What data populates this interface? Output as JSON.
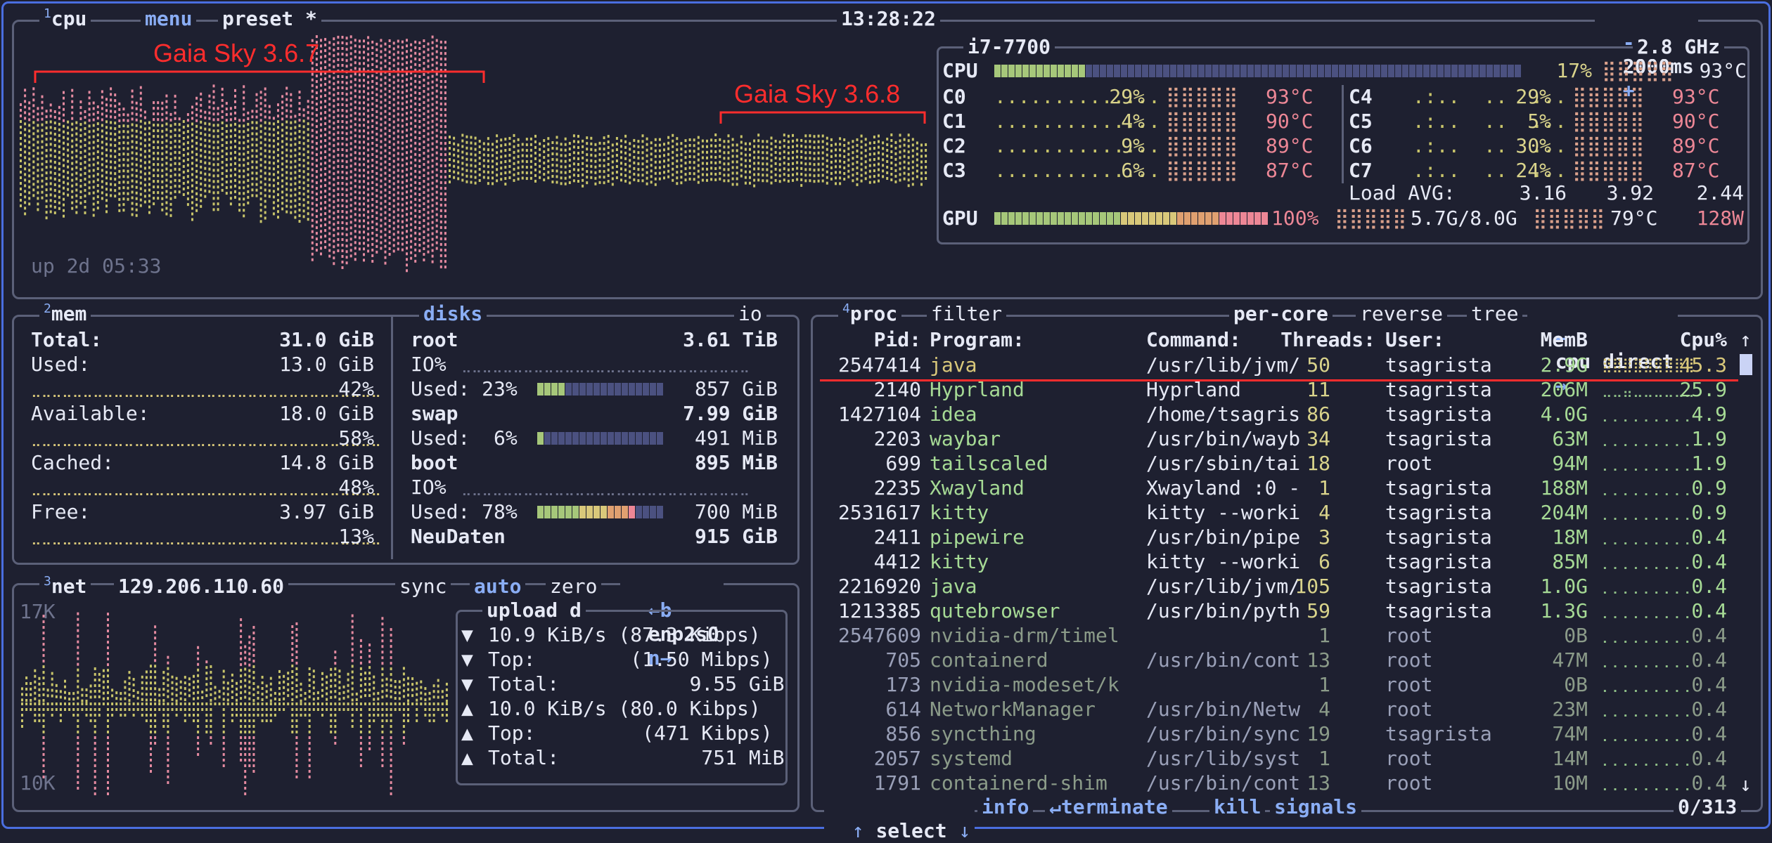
{
  "cpu_box": {
    "num": "1",
    "title": "cpu",
    "menu": "menu",
    "preset": "preset *",
    "clock": "13:28:22",
    "interval_minus": "-",
    "interval": "2000ms",
    "interval_plus": "+",
    "uptime": "up 2d 05:33",
    "model": "i7-7700",
    "freq": "2.8 GHz",
    "total_label": "CPU",
    "total_pct": "17%",
    "total_temp": "93°C",
    "total_value": 17,
    "cores": [
      {
        "name": "C0",
        "pct": "29%",
        "temp": "93°C"
      },
      {
        "name": "C1",
        "pct": "4%",
        "temp": "90°C"
      },
      {
        "name": "C2",
        "pct": "9%",
        "temp": "89°C"
      },
      {
        "name": "C3",
        "pct": "6%",
        "temp": "87°C"
      },
      {
        "name": "C4",
        "pct": "29%",
        "temp": "93°C"
      },
      {
        "name": "C5",
        "pct": "5%",
        "temp": "90°C"
      },
      {
        "name": "C6",
        "pct": "30%",
        "temp": "89°C"
      },
      {
        "name": "C7",
        "pct": "24%",
        "temp": "87°C"
      }
    ],
    "load_label": "Load AVG:",
    "load": [
      "3.16",
      "3.92",
      "2.44"
    ],
    "gpu_label": "GPU",
    "gpu_pct": "100%",
    "gpu_value": 100,
    "gpu_mem": "5.7G/8.0G",
    "gpu_temp": "79°C",
    "gpu_power": "128W"
  },
  "annotations": {
    "left": "Gaia Sky 3.6.7",
    "right": "Gaia Sky 3.6.8"
  },
  "mem_box": {
    "num": "2",
    "title": "mem",
    "total_label": "Total:",
    "total": "31.0 GiB",
    "used_label": "Used:",
    "used": "13.0 GiB",
    "used_pct": "42%",
    "avail_label": "Available:",
    "avail": "18.0 GiB",
    "avail_pct": "58%",
    "cached_label": "Cached:",
    "cached": "14.8 GiB",
    "cached_pct": "48%",
    "free_label": "Free:",
    "free": "3.97 GiB",
    "free_pct": "13%"
  },
  "disks_box": {
    "title": "disks",
    "io": "io",
    "root_name": "root",
    "root_size": "3.61 TiB",
    "root_io": "IO%",
    "root_used_label": "Used: 23%",
    "root_used": "857 GiB",
    "root_value": 23,
    "swap_name": "swap",
    "swap_size": "7.99 GiB",
    "swap_used_label": "Used:  6%",
    "swap_used": "491 MiB",
    "swap_value": 6,
    "boot_name": "boot",
    "boot_size": "895 MiB",
    "boot_io": "IO%",
    "boot_used_label": "Used: 78%",
    "boot_used": "700 MiB",
    "boot_value": 78,
    "neu_name": "NeuDaten",
    "neu_size": "915 GiB"
  },
  "net_box": {
    "num": "3",
    "title": "net",
    "ip": "129.206.110.60",
    "sync": "sync",
    "auto": "auto",
    "zero": "zero",
    "prev": "←b",
    "iface": "enp2s0",
    "next": "n→",
    "scale_top": "17K",
    "scale_bottom": "10K",
    "up_label": "upload",
    "down_label": "d",
    "rows": [
      {
        "arrow": "▼",
        "text": "10.9 KiB/s (87.3 Kibps)"
      },
      {
        "arrow": "▼",
        "text": "Top:        (1.50 Mibps)"
      },
      {
        "arrow": "▼",
        "text": "Total:           9.55 GiB"
      },
      {
        "arrow": "▲",
        "text": "10.0 KiB/s (80.0 Kibps)"
      },
      {
        "arrow": "▲",
        "text": "Top:         (471 Kibps)"
      },
      {
        "arrow": "▲",
        "text": "Total:            751 MiB"
      }
    ]
  },
  "proc_box": {
    "num": "4",
    "title": "proc",
    "filter": "filter",
    "per_core": "per-core",
    "reverse": "reverse",
    "tree": "tree",
    "sort_prev": "←",
    "sort": "cpu direct",
    "sort_next": "→",
    "headers": {
      "pid": "Pid:",
      "program": "Program:",
      "command": "Command:",
      "threads": "Threads:",
      "user": "User:",
      "memb": "MemB",
      "cpu": "Cpu%"
    },
    "rows": [
      {
        "pid": "2547414",
        "program": "java",
        "command": "/usr/lib/jvm/",
        "threads": "50",
        "user": "tsagrista",
        "mem": "2.9G",
        "cpu": "45.3"
      },
      {
        "pid": "2140",
        "program": "Hyprland",
        "command": "Hyprland",
        "threads": "11",
        "user": "tsagrista",
        "mem": "206M",
        "cpu": "25.9"
      },
      {
        "pid": "1427104",
        "program": "idea",
        "command": "/home/tsagris",
        "threads": "86",
        "user": "tsagrista",
        "mem": "4.0G",
        "cpu": "4.9"
      },
      {
        "pid": "2203",
        "program": "waybar",
        "command": "/usr/bin/wayb",
        "threads": "34",
        "user": "tsagrista",
        "mem": "63M",
        "cpu": "1.9"
      },
      {
        "pid": "699",
        "program": "tailscaled",
        "command": "/usr/sbin/tai",
        "threads": "18",
        "user": "root",
        "mem": "94M",
        "cpu": "1.9"
      },
      {
        "pid": "2235",
        "program": "Xwayland",
        "command": "Xwayland :0 -",
        "threads": "1",
        "user": "tsagrista",
        "mem": "188M",
        "cpu": "0.9"
      },
      {
        "pid": "2531617",
        "program": "kitty",
        "command": "kitty --worki",
        "threads": "4",
        "user": "tsagrista",
        "mem": "204M",
        "cpu": "0.9"
      },
      {
        "pid": "2411",
        "program": "pipewire",
        "command": "/usr/bin/pipe",
        "threads": "3",
        "user": "tsagrista",
        "mem": "18M",
        "cpu": "0.4"
      },
      {
        "pid": "4412",
        "program": "kitty",
        "command": "kitty --worki",
        "threads": "6",
        "user": "tsagrista",
        "mem": "85M",
        "cpu": "0.4"
      },
      {
        "pid": "2216920",
        "program": "java",
        "command": "/usr/lib/jvm/",
        "threads": "105",
        "user": "tsagrista",
        "mem": "1.0G",
        "cpu": "0.4"
      },
      {
        "pid": "1213385",
        "program": "qutebrowser",
        "command": "/usr/bin/pyth",
        "threads": "59",
        "user": "tsagrista",
        "mem": "1.3G",
        "cpu": "0.4"
      },
      {
        "pid": "2547609",
        "program": "nvidia-drm/timel",
        "command": "",
        "threads": "1",
        "user": "root",
        "mem": "0B",
        "cpu": "0.4"
      },
      {
        "pid": "705",
        "program": "containerd",
        "command": "/usr/bin/cont",
        "threads": "13",
        "user": "root",
        "mem": "47M",
        "cpu": "0.4"
      },
      {
        "pid": "173",
        "program": "nvidia-modeset/k",
        "command": "",
        "threads": "1",
        "user": "root",
        "mem": "0B",
        "cpu": "0.4"
      },
      {
        "pid": "614",
        "program": "NetworkManager",
        "command": "/usr/bin/Netw",
        "threads": "4",
        "user": "root",
        "mem": "23M",
        "cpu": "0.4"
      },
      {
        "pid": "856",
        "program": "syncthing",
        "command": "/usr/bin/sync",
        "threads": "19",
        "user": "tsagrista",
        "mem": "74M",
        "cpu": "0.4"
      },
      {
        "pid": "2057",
        "program": "systemd",
        "command": "/usr/lib/syst",
        "threads": "1",
        "user": "root",
        "mem": "14M",
        "cpu": "0.4"
      },
      {
        "pid": "1791",
        "program": "containerd-shim",
        "command": "/usr/bin/cont",
        "threads": "13",
        "user": "root",
        "mem": "10M",
        "cpu": "0.4"
      }
    ],
    "footer": {
      "up": "↑",
      "select": "select",
      "down": "↓",
      "info": "info",
      "enter": "↵",
      "terminate": "terminate",
      "kill": "kill",
      "signals": "signals",
      "count": "0/313"
    },
    "scroll_up": "↑",
    "scroll_down": "↓"
  },
  "colors": {
    "accent": "#8aadf4",
    "border": "#5b6078",
    "green": "#a6da95",
    "annotation": "#ff2d2d",
    "background": "#1e2030"
  }
}
